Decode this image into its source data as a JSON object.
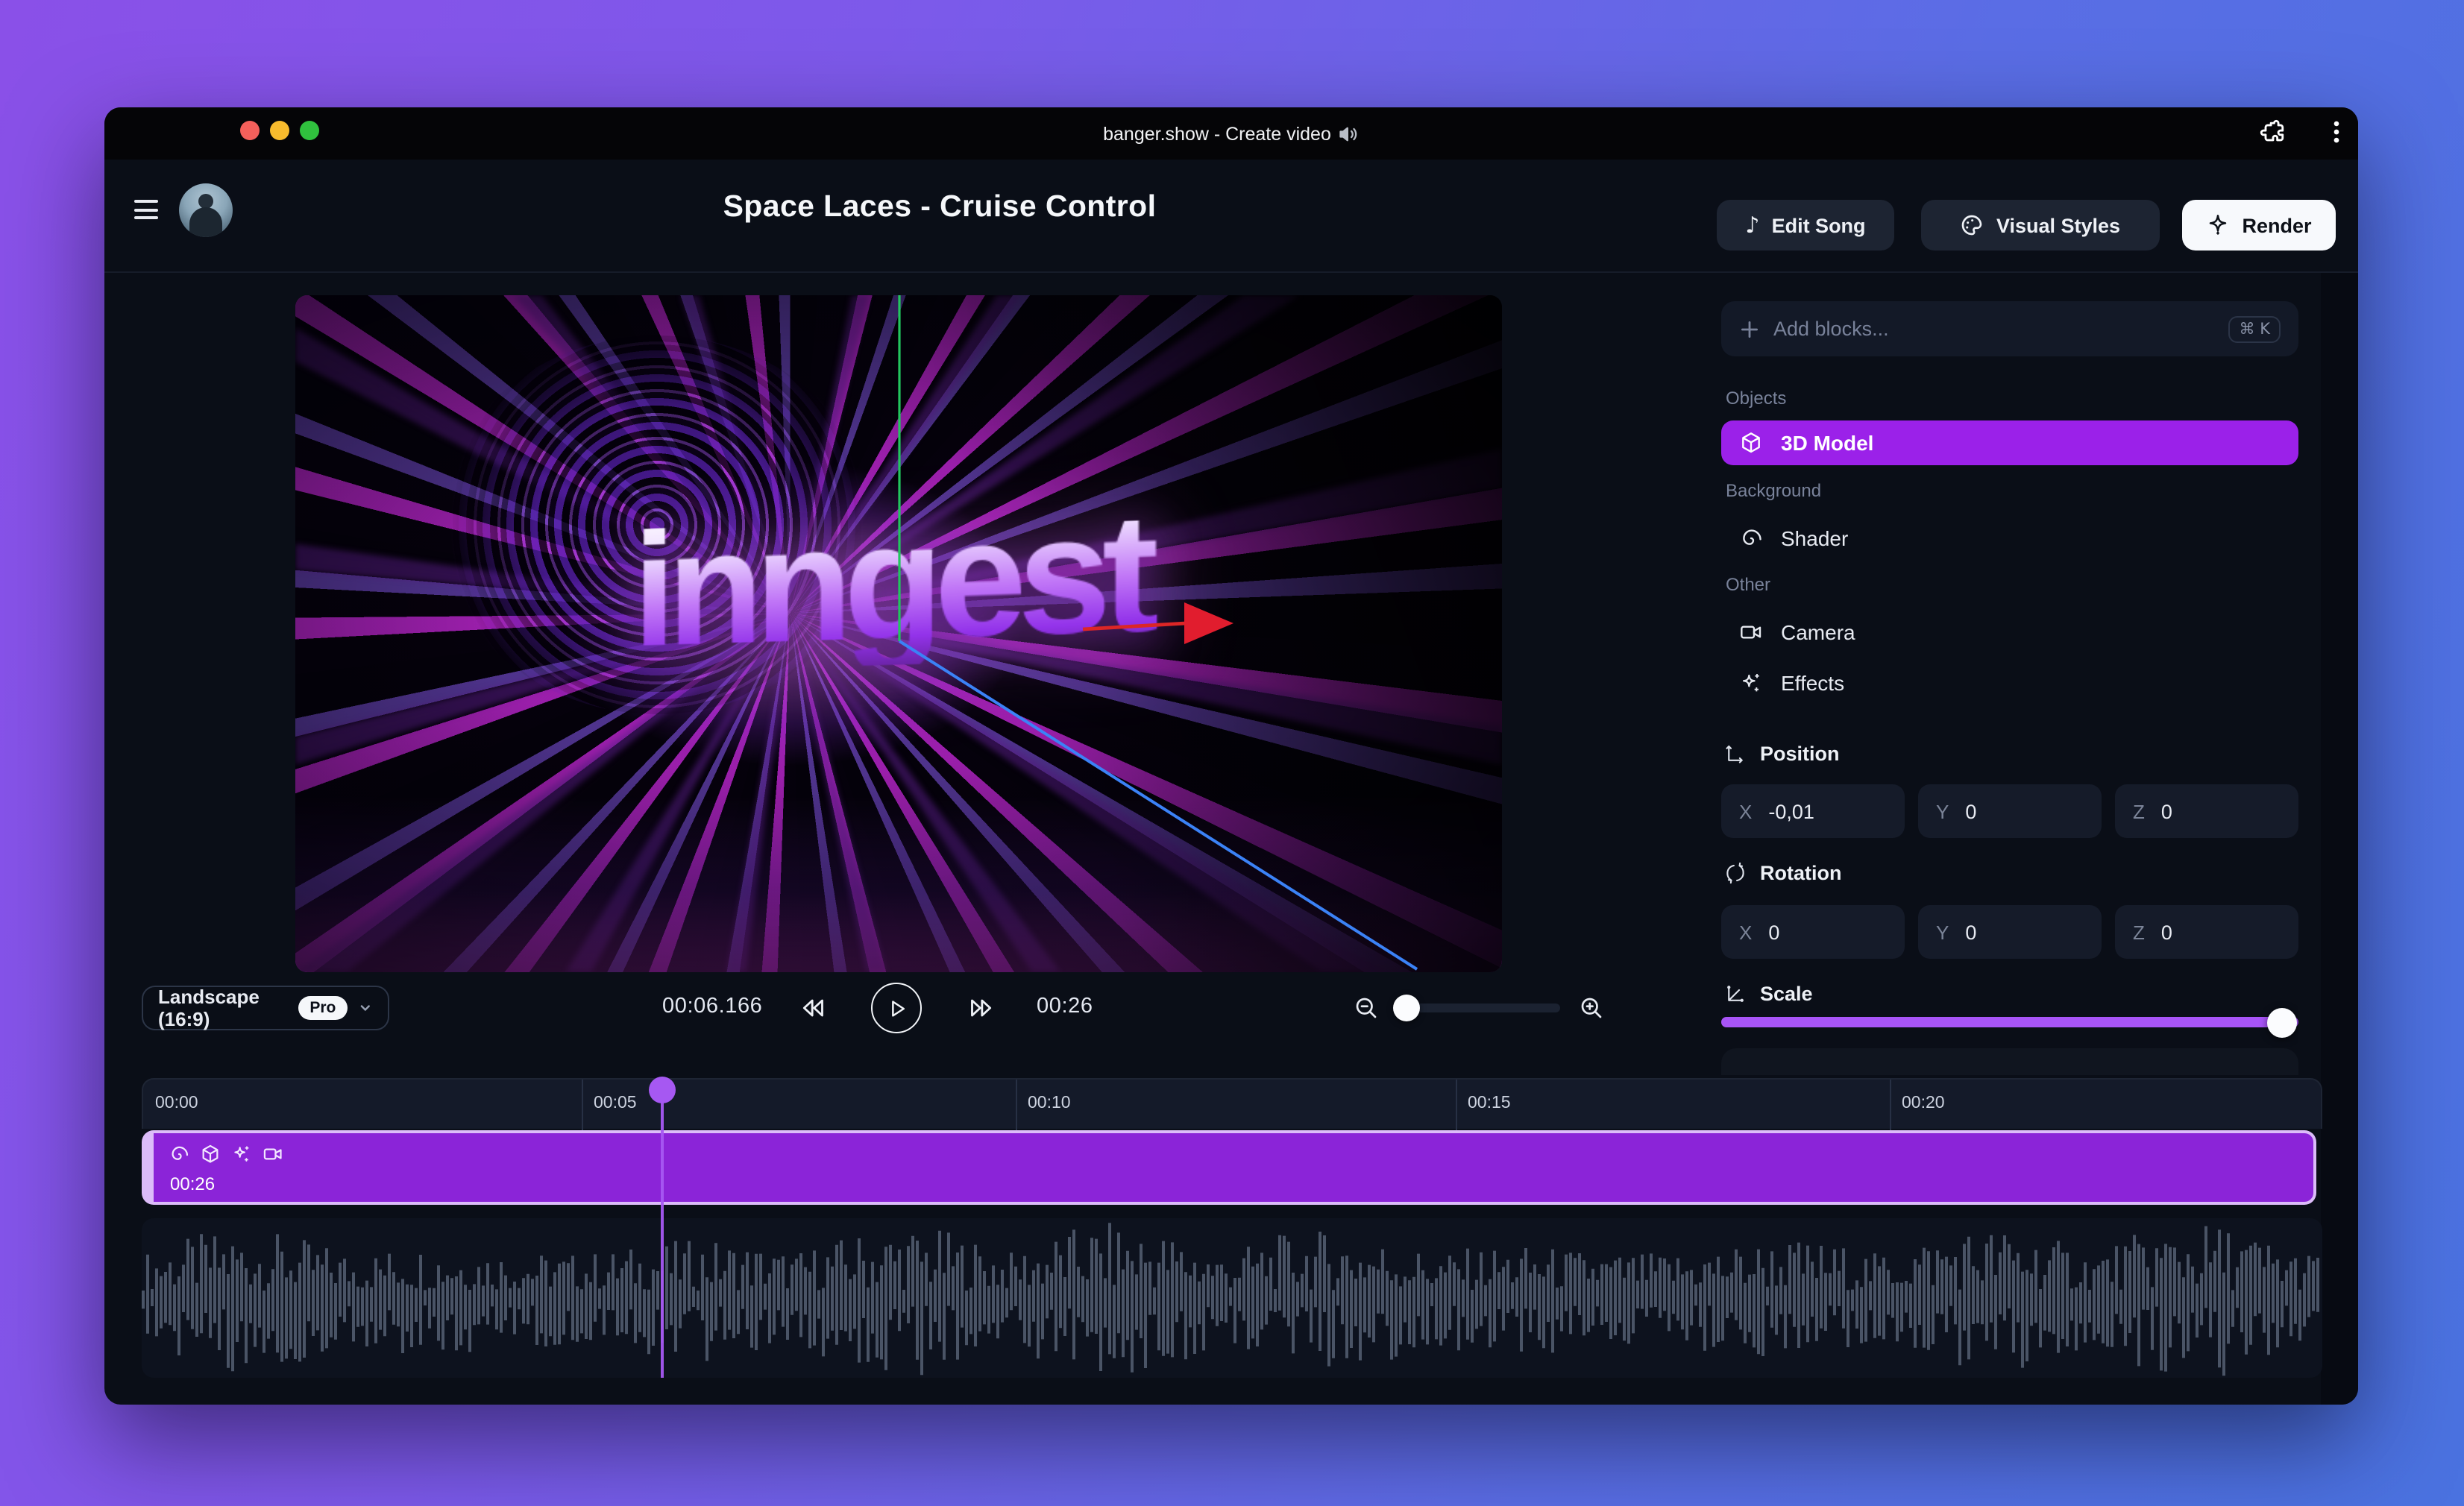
{
  "colors": {
    "accent_purple": "#9b21e9",
    "slider_purple": "#a854f7",
    "playhead_purple": "#a658f2",
    "clip_purple": "#8b24d8",
    "render_button_bg": "#f7f9fc"
  },
  "titlebar": {
    "title": "banger.show - Create video",
    "title_icon": "speaker"
  },
  "header": {
    "project_title": "Space Laces - Cruise Control",
    "edit_song_label": "Edit Song",
    "visual_styles_label": "Visual Styles",
    "render_label": "Render"
  },
  "preview": {
    "overlay_text": "inngest"
  },
  "controls": {
    "aspect_ratio": "Landscape (16:9)",
    "plan_badge": "Pro",
    "current_time": "00:06.166",
    "total_time": "00:26"
  },
  "sidebar": {
    "add_blocks_placeholder": "Add blocks...",
    "shortcut": "⌘ K",
    "sections": {
      "objects": "Objects",
      "background": "Background",
      "other": "Other"
    },
    "items": {
      "model": "3D Model",
      "shader": "Shader",
      "camera": "Camera",
      "effects": "Effects"
    },
    "position": {
      "label": "Position",
      "fields": [
        {
          "axis": "X",
          "value": "-0,01"
        },
        {
          "axis": "Y",
          "value": "0"
        },
        {
          "axis": "Z",
          "value": "0"
        }
      ]
    },
    "rotation": {
      "label": "Rotation",
      "fields": [
        {
          "axis": "X",
          "value": "0"
        },
        {
          "axis": "Y",
          "value": "0"
        },
        {
          "axis": "Z",
          "value": "0"
        }
      ]
    },
    "scale": {
      "label": "Scale"
    }
  },
  "timeline": {
    "ruler": [
      "00:00",
      "00:05",
      "00:10",
      "00:15",
      "00:20"
    ],
    "clip_duration": "00:26",
    "clip_icons": [
      "shader",
      "3d-model",
      "effects",
      "camera"
    ]
  }
}
